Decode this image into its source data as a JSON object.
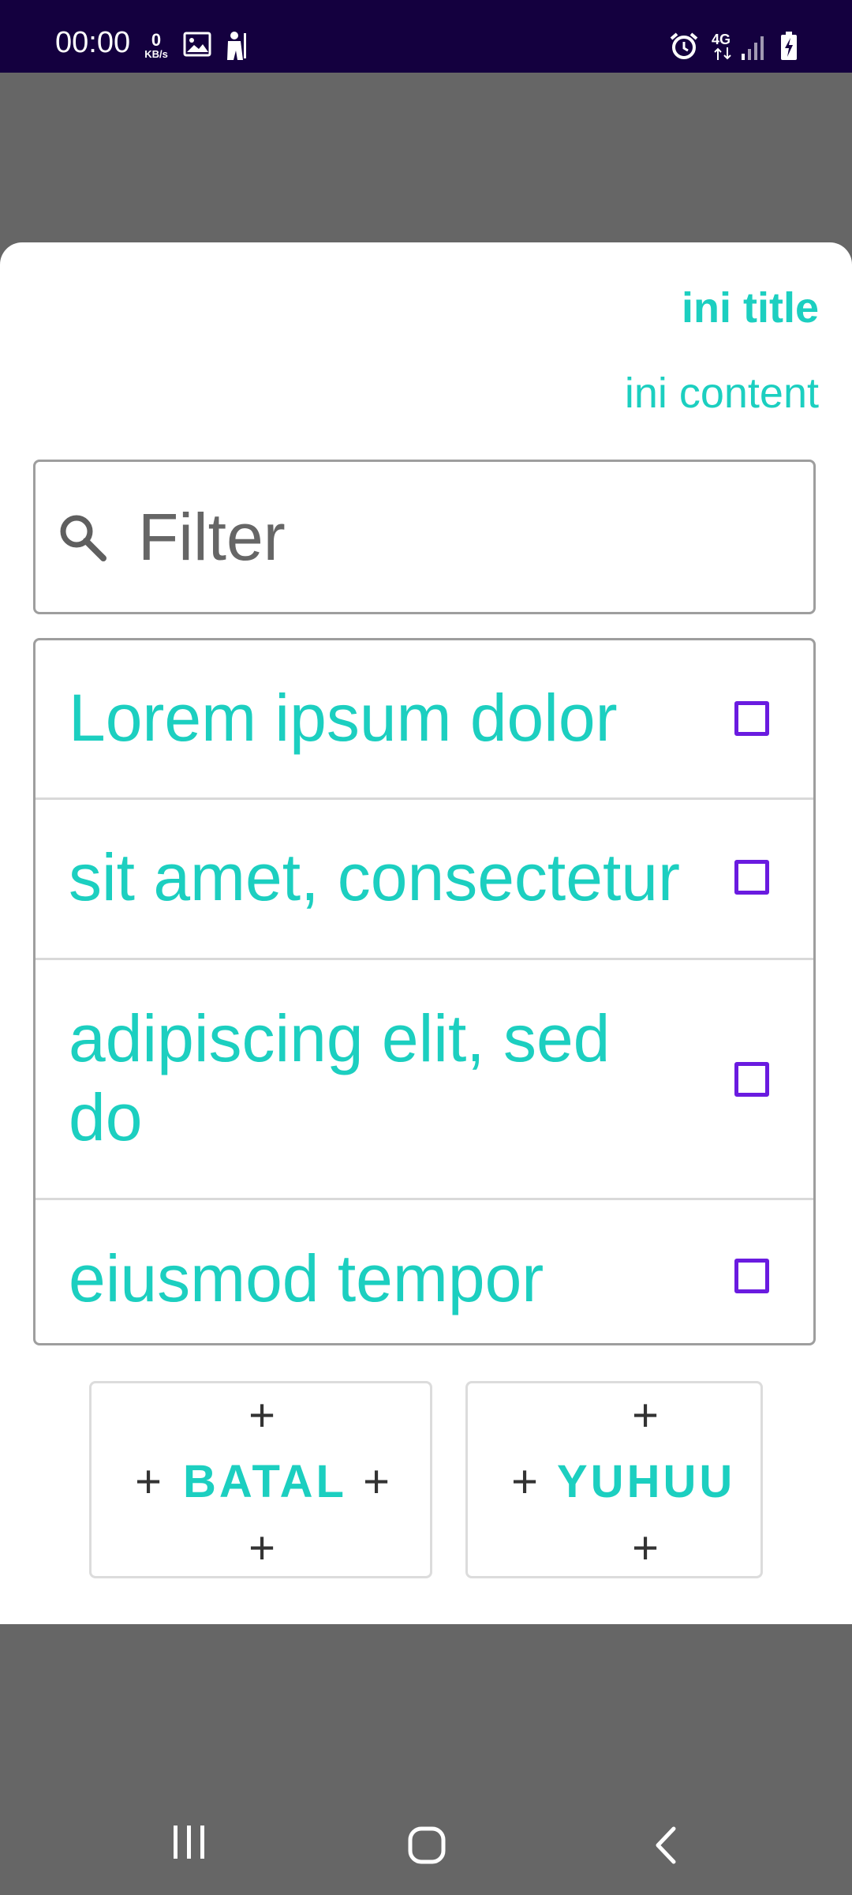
{
  "status_bar": {
    "time": "00:00",
    "speed_value": "0",
    "speed_unit": "KB/s",
    "network": "4G",
    "background_color": "#14003f"
  },
  "dialog": {
    "title": "ini title",
    "content": "ini content",
    "accent_color": "#1ccfc0",
    "checkbox_color": "#6a1be0"
  },
  "filter": {
    "placeholder": "Filter",
    "value": "",
    "icon": "search-icon"
  },
  "items": [
    {
      "label": "Lorem ipsum dolor",
      "checked": false
    },
    {
      "label": "sit amet, consectetur",
      "checked": false
    },
    {
      "label": "adipiscing elit, sed do",
      "checked": false
    },
    {
      "label": "eiusmod tempor",
      "checked": false
    }
  ],
  "buttons": {
    "batal": {
      "label": "BATAL",
      "decoration": "+"
    },
    "yuhuu": {
      "label": "YUHUU",
      "decoration": "+"
    }
  },
  "nav_bar": {
    "icons": [
      "recents-icon",
      "home-icon",
      "back-icon"
    ]
  }
}
